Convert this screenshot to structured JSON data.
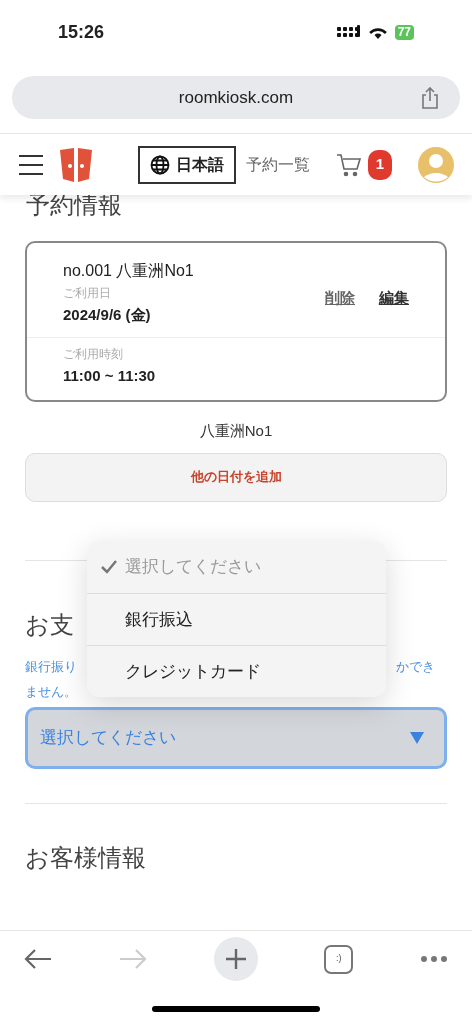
{
  "status_bar": {
    "time": "15:26",
    "battery": "77"
  },
  "browser": {
    "url": "roomkiosk.com"
  },
  "header": {
    "language": "日本語",
    "reservations_link": "予約一覧",
    "cart_count": "1"
  },
  "reservation": {
    "heading": "予約情報",
    "card": {
      "title": "no.001 八重洲No1",
      "date_label": "ご利用日",
      "date": "2024/9/6 (金)",
      "delete": "削除",
      "edit": "編集",
      "time_label": "ご利用時刻",
      "time": "11:00 ~ 11:30"
    },
    "room_name": "八重洲No1",
    "add_date_button": "他の日付を追加"
  },
  "payment": {
    "heading": "お支",
    "hint_parts": [
      "銀行振り",
      "かでき",
      "ません。"
    ],
    "select": {
      "value": "選択してください",
      "focused": true
    },
    "options": [
      {
        "label": "選択してください",
        "selected": true
      },
      {
        "label": "銀行振込",
        "selected": false
      },
      {
        "label": "クレジットカード",
        "selected": false
      }
    ]
  },
  "customer": {
    "heading": "お客様情報"
  },
  "toolbar": {
    "back_enabled": true,
    "forward_enabled": false,
    "tabs_label": ":)"
  }
}
